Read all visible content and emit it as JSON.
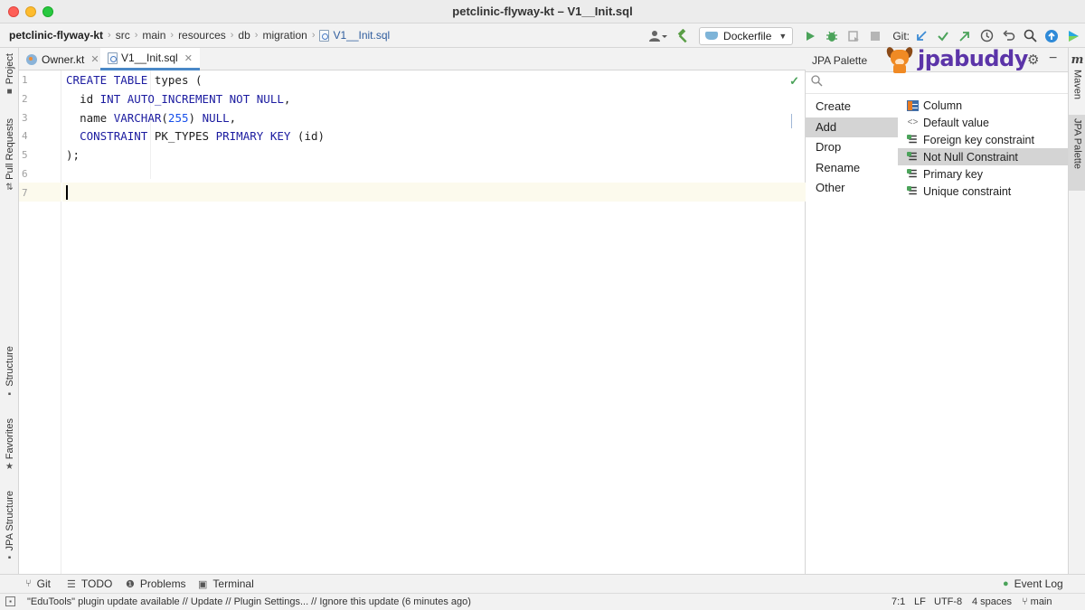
{
  "window": {
    "title": "petclinic-flyway-kt – V1__Init.sql"
  },
  "breadcrumbs": {
    "project": "petclinic-flyway-kt",
    "parts": [
      "src",
      "main",
      "resources",
      "db",
      "migration"
    ],
    "file": "V1__Init.sql"
  },
  "toolbar": {
    "run_config": "Dockerfile",
    "git_label": "Git:",
    "icons": [
      "user-icon",
      "hammer-icon",
      "run-icon",
      "debug-icon",
      "coverage-icon",
      "stop-icon",
      "git-update-icon",
      "git-commit-icon",
      "git-push-icon",
      "history-icon",
      "rollback-icon",
      "search-icon",
      "update-icon",
      "toolbox-icon"
    ]
  },
  "left_tools": [
    "Project",
    "Pull Requests",
    "Structure",
    "Favorites",
    "JPA Structure"
  ],
  "tabs": [
    {
      "label": "Owner.kt",
      "active": false
    },
    {
      "label": "V1__Init.sql",
      "active": true
    }
  ],
  "editor": {
    "line_numbers": [
      "1",
      "2",
      "3",
      "4",
      "5",
      "6",
      "7"
    ],
    "lines": [
      "CREATE TABLE types (",
      "  id INT AUTO_INCREMENT NOT NULL,",
      "  name VARCHAR(255) NULL,",
      "  CONSTRAINT PK_TYPES PRIMARY KEY (id)",
      ");",
      "",
      ""
    ],
    "caret_line": 7
  },
  "palette": {
    "title": "JPA Palette",
    "brand": "jpabuddy",
    "categories": [
      {
        "label": "Create",
        "selected": false
      },
      {
        "label": "Add",
        "selected": true
      },
      {
        "label": "Drop",
        "selected": false
      },
      {
        "label": "Rename",
        "selected": false
      },
      {
        "label": "Other",
        "selected": false
      }
    ],
    "items": [
      {
        "label": "Column",
        "icon": "column-icon",
        "selected": false
      },
      {
        "label": "Default value",
        "icon": "default-value-icon",
        "selected": false
      },
      {
        "label": "Foreign key constraint",
        "icon": "constraint-icon",
        "selected": false
      },
      {
        "label": "Not Null Constraint",
        "icon": "constraint-icon",
        "selected": true
      },
      {
        "label": "Primary key",
        "icon": "constraint-icon",
        "selected": false
      },
      {
        "label": "Unique constraint",
        "icon": "constraint-icon",
        "selected": false
      }
    ]
  },
  "right_tools": [
    "Maven",
    "JPA Palette"
  ],
  "bottom_tools": [
    "Git",
    "TODO",
    "Problems",
    "Terminal",
    "Event Log"
  ],
  "status": {
    "message": "\"EduTools\" plugin update available // Update // Plugin Settings... // Ignore this update (6 minutes ago)",
    "position": "7:1",
    "line_separator": "LF",
    "encoding": "UTF-8",
    "indent": "4 spaces",
    "branch": "main"
  },
  "colors": {
    "keyword": "#1c1ca0",
    "number": "#1750eb",
    "selection": "#d4d4d4",
    "brand": "#5b34a8",
    "accent_tab": "#4a88c7"
  }
}
